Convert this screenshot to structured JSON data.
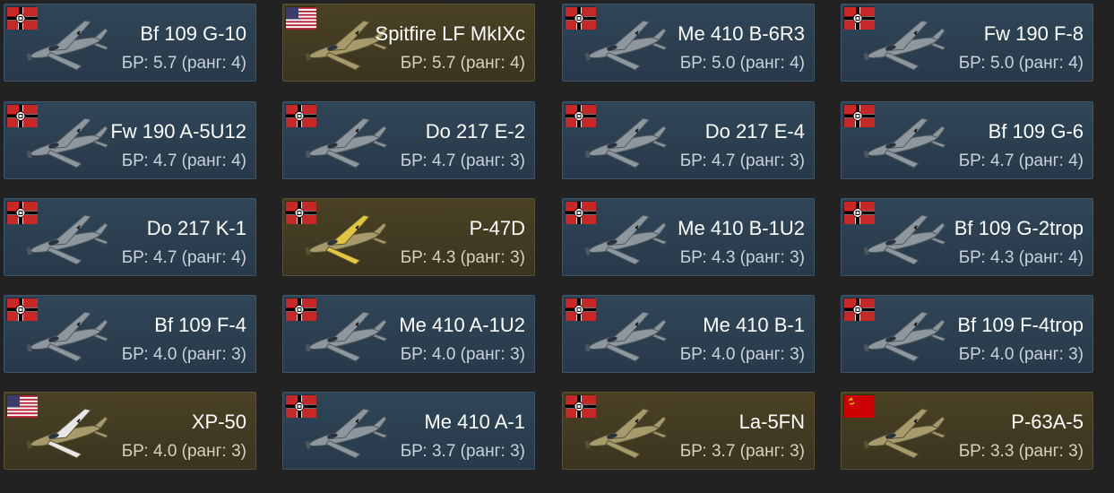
{
  "vehicles": [
    {
      "name": "Bf 109 G-10",
      "br": "БР: 5.7 (ранг: 4)",
      "flag": "germany-flag-icon",
      "premium": false
    },
    {
      "name": "Spitfire LF MkIXc",
      "br": "БР: 5.7 (ранг: 4)",
      "flag": "usa-flag-icon",
      "premium": true
    },
    {
      "name": "Me 410 B-6R3",
      "br": "БР: 5.0 (ранг: 4)",
      "flag": "germany-flag-icon",
      "premium": false
    },
    {
      "name": "Fw 190 F-8",
      "br": "БР: 5.0 (ранг: 4)",
      "flag": "germany-flag-icon",
      "premium": false
    },
    {
      "name": "Fw 190 A-5U12",
      "br": "БР: 4.7 (ранг: 4)",
      "flag": "germany-flag-icon",
      "premium": false
    },
    {
      "name": "Do 217 E-2",
      "br": "БР: 4.7 (ранг: 3)",
      "flag": "germany-flag-icon",
      "premium": false
    },
    {
      "name": "Do 217 E-4",
      "br": "БР: 4.7 (ранг: 3)",
      "flag": "germany-flag-icon",
      "premium": false
    },
    {
      "name": "Bf 109 G-6",
      "br": "БР: 4.7 (ранг: 4)",
      "flag": "germany-flag-icon",
      "premium": false
    },
    {
      "name": "Do 217 K-1",
      "br": "БР: 4.7 (ранг: 4)",
      "flag": "germany-flag-icon",
      "premium": false
    },
    {
      "name": "P-47D",
      "br": "БР: 4.3 (ранг: 3)",
      "flag": "germany-flag-icon",
      "premium": true
    },
    {
      "name": "Me 410 B-1U2",
      "br": "БР: 4.3 (ранг: 3)",
      "flag": "germany-flag-icon",
      "premium": false
    },
    {
      "name": "Bf 109 G-2trop",
      "br": "БР: 4.3 (ранг: 4)",
      "flag": "germany-flag-icon",
      "premium": false
    },
    {
      "name": "Bf 109 F-4",
      "br": "БР: 4.0 (ранг: 3)",
      "flag": "germany-flag-icon",
      "premium": false
    },
    {
      "name": "Me 410 A-1U2",
      "br": "БР: 4.0 (ранг: 3)",
      "flag": "germany-flag-icon",
      "premium": false
    },
    {
      "name": "Me 410 B-1",
      "br": "БР: 4.0 (ранг: 3)",
      "flag": "germany-flag-icon",
      "premium": false
    },
    {
      "name": "Bf 109 F-4trop",
      "br": "БР: 4.0 (ранг: 3)",
      "flag": "germany-flag-icon",
      "premium": false
    },
    {
      "name": "XP-50",
      "br": "БР: 4.0 (ранг: 3)",
      "flag": "usa-flag-icon",
      "premium": true
    },
    {
      "name": "Me 410 A-1",
      "br": "БР: 3.7 (ранг: 3)",
      "flag": "germany-flag-icon",
      "premium": false
    },
    {
      "name": "La-5FN",
      "br": "БР: 3.7 (ранг: 3)",
      "flag": "germany-flag-icon",
      "premium": true
    },
    {
      "name": "P-63A-5",
      "br": "БР: 3.3 (ранг: 3)",
      "flag": "ussr-flag-icon",
      "premium": true
    }
  ],
  "colors": {
    "card_bg": "#2f4658",
    "card_premium_bg": "#4b4224",
    "text": "#ffffff",
    "subtext": "#c9d2da"
  }
}
